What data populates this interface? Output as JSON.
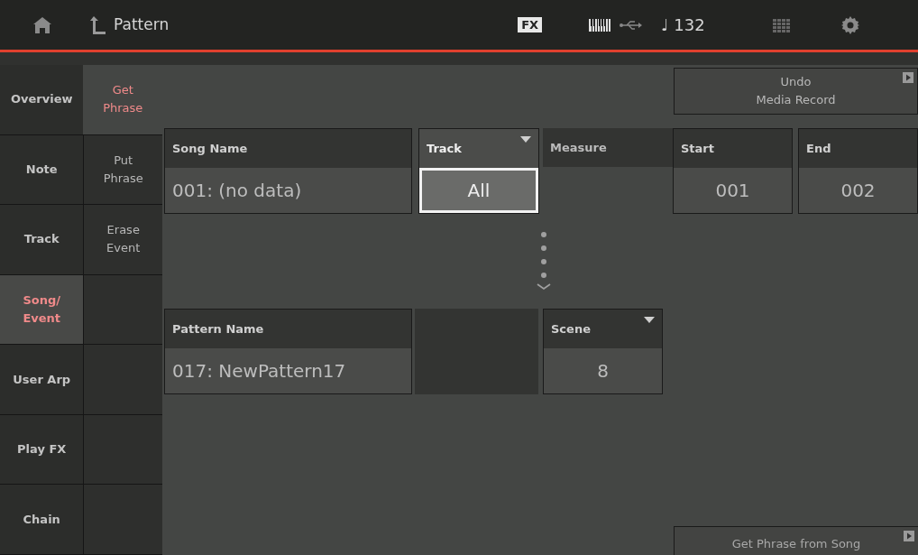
{
  "header": {
    "title": "Pattern",
    "fx": "FX",
    "tempo": "♩ 132"
  },
  "main_tabs": [
    {
      "label": "Overview",
      "selected": false
    },
    {
      "label": "Note",
      "selected": false
    },
    {
      "label": "Track",
      "selected": false
    },
    {
      "label": "Song/\nEvent",
      "selected": true
    },
    {
      "label": "User Arp",
      "selected": false
    },
    {
      "label": "Play FX",
      "selected": false
    },
    {
      "label": "Chain",
      "selected": false
    }
  ],
  "sub_tabs": [
    {
      "label": "Get\nPhrase",
      "selected": true
    },
    {
      "label": "Put\nPhrase",
      "selected": false
    },
    {
      "label": "Erase\nEvent",
      "selected": false
    }
  ],
  "undo_button": {
    "label": "Undo\nMedia Record"
  },
  "song_name": {
    "label": "Song Name",
    "value": "001: (no data)"
  },
  "track": {
    "label": "Track",
    "value": "All",
    "selected": true
  },
  "measure": {
    "label": "Measure",
    "start": {
      "label": "Start",
      "value": "001"
    },
    "end": {
      "label": "End",
      "value": "002"
    }
  },
  "pattern_name": {
    "label": "Pattern Name",
    "value": "017: NewPattern17"
  },
  "scene": {
    "label": "Scene",
    "value": "8"
  },
  "action_button": {
    "label": "Get Phrase from Song"
  }
}
